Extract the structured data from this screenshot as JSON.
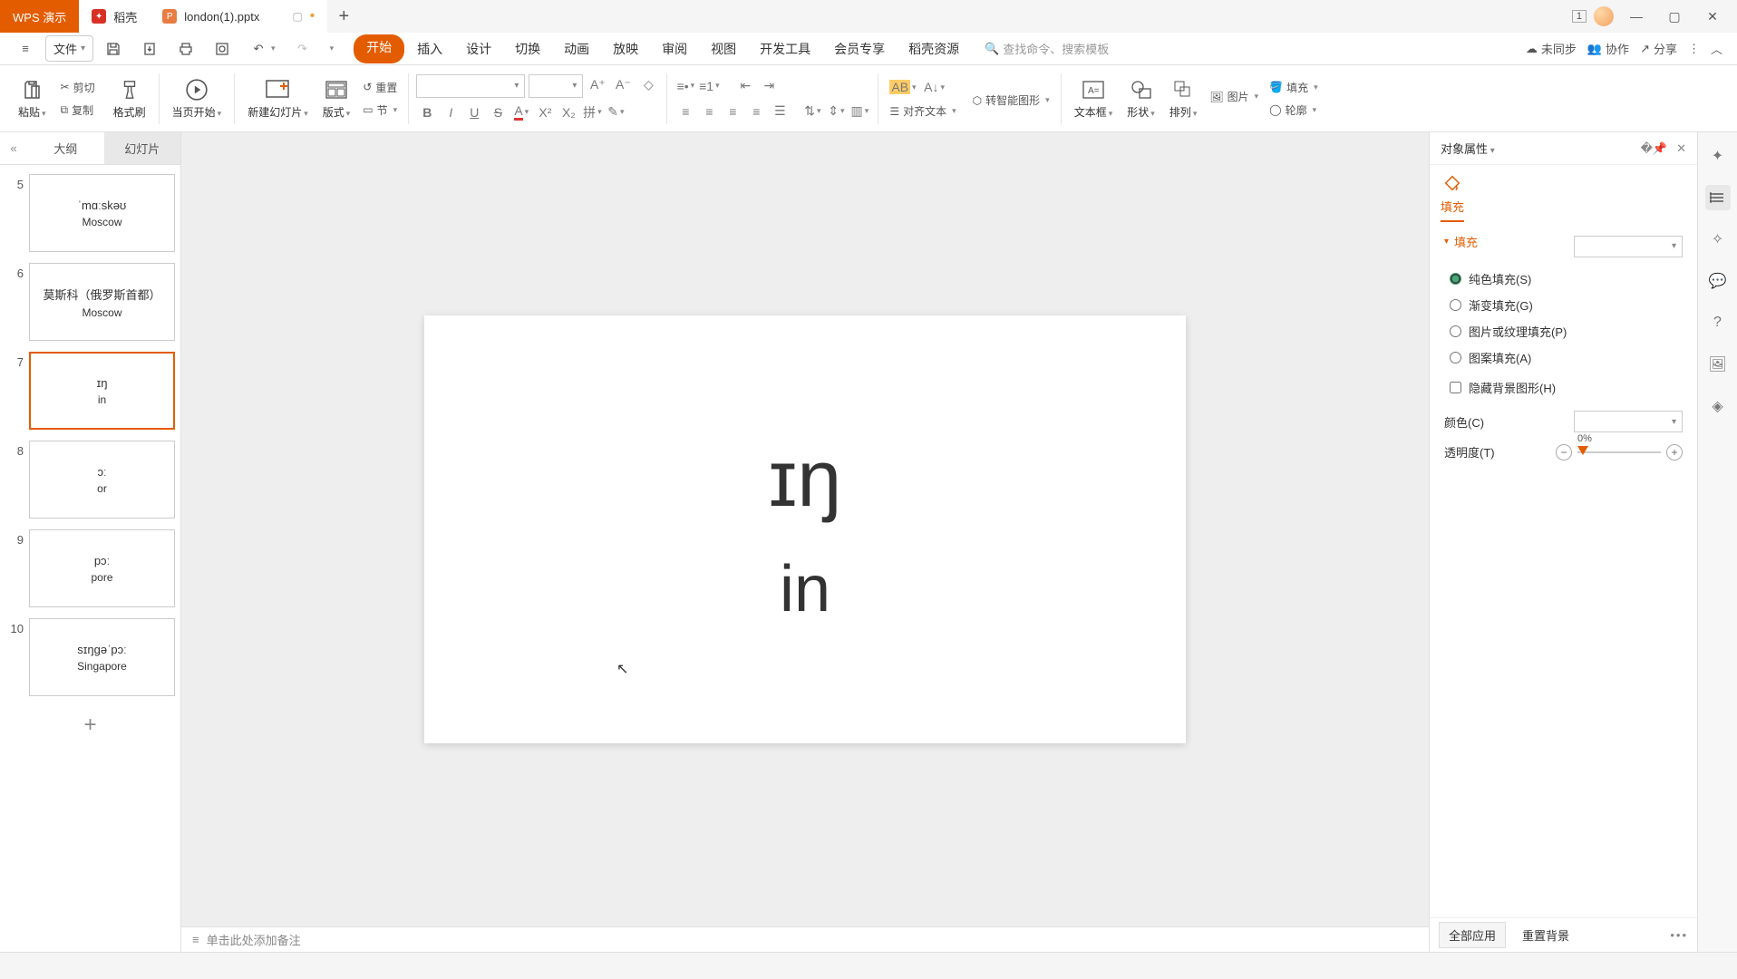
{
  "title_bar": {
    "app_tab": "WPS 演示",
    "docer_tab": "稻壳",
    "file_tab": "london(1).pptx",
    "badge_num": "1"
  },
  "menu": {
    "file": "文件",
    "tabs": [
      "开始",
      "插入",
      "设计",
      "切换",
      "动画",
      "放映",
      "审阅",
      "视图",
      "开发工具",
      "会员专享",
      "稻壳资源"
    ],
    "active_tab": 0,
    "search_placeholder": "查找命令、搜索模板",
    "unsync": "未同步",
    "collab": "协作",
    "share": "分享"
  },
  "ribbon": {
    "paste": "粘贴",
    "cut": "剪切",
    "copy": "复制",
    "format_painter": "格式刷",
    "from_current": "当页开始",
    "new_slide": "新建幻灯片",
    "layout": "版式",
    "reset": "重置",
    "section": "节",
    "align_text": "对齐文本",
    "smart_art": "转智能图形",
    "text_box": "文本框",
    "shape": "形状",
    "arrange": "排列",
    "picture": "图片",
    "fill": "填充",
    "outline": "轮廓"
  },
  "left_panel": {
    "tab_outline": "大纲",
    "tab_slides": "幻灯片",
    "thumbs": [
      {
        "num": 5,
        "l1": "ˈmɑːskəʊ",
        "l2": "Moscow"
      },
      {
        "num": 6,
        "l1": "莫斯科（俄罗斯首都）",
        "l2": "Moscow"
      },
      {
        "num": 7,
        "l1": "ɪŋ",
        "l2": "in"
      },
      {
        "num": 8,
        "l1": "ɔː",
        "l2": "or"
      },
      {
        "num": 9,
        "l1": "pɔː",
        "l2": "pore"
      },
      {
        "num": 10,
        "l1": "sɪŋgəˈpɔː",
        "l2": "Singapore"
      }
    ],
    "selected_index": 2
  },
  "slide": {
    "line1": "ɪŋ",
    "line2": "in"
  },
  "notes_placeholder": "单击此处添加备注",
  "right_panel": {
    "title": "对象属性",
    "tab_fill": "填充",
    "section_fill": "填充",
    "radio_solid": "纯色填充(S)",
    "radio_gradient": "渐变填充(G)",
    "radio_picture": "图片或纹理填充(P)",
    "radio_pattern": "图案填充(A)",
    "check_hide": "隐藏背景图形(H)",
    "color_label": "颜色(C)",
    "opacity_label": "透明度(T)",
    "opacity_value": "0%",
    "apply_all": "全部应用",
    "reset_bg": "重置背景"
  }
}
